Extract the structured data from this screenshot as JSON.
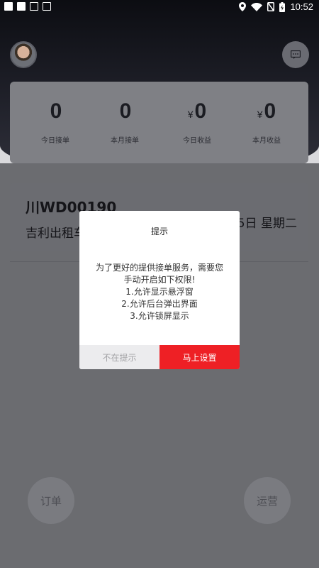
{
  "status_bar": {
    "time": "10:52",
    "icons": [
      "notification-square-icon",
      "notification-square-icon",
      "image-icon",
      "font-icon",
      "location-icon",
      "wifi-icon",
      "no-sim-icon",
      "battery-charging-icon"
    ]
  },
  "header": {
    "avatar_icon": "avatar",
    "message_icon": "message-icon"
  },
  "stats": [
    {
      "value": "0",
      "label": "今日接单",
      "currency": ""
    },
    {
      "value": "0",
      "label": "本月接单",
      "currency": ""
    },
    {
      "value": "0",
      "label": "今日收益",
      "currency": "¥"
    },
    {
      "value": "0",
      "label": "本月收益",
      "currency": "¥"
    }
  ],
  "driver": {
    "plate": "川WD00190",
    "company": "吉利出租车",
    "date": "5日 星期二"
  },
  "bottom_nav": {
    "orders_label": "订单",
    "operations_label": "运营"
  },
  "dialog": {
    "title": "提示",
    "body_lines": [
      "为了更好的提供接单服务，需要您",
      "手动开启如下权限!",
      "1.允许显示悬浮窗",
      "2.允许后台弹出界面",
      "3.允许锁屏显示"
    ],
    "cancel_label": "不在提示",
    "confirm_label": "马上设置"
  },
  "colors": {
    "accent": "#ee2025",
    "header_dark": "#0c0d12"
  }
}
